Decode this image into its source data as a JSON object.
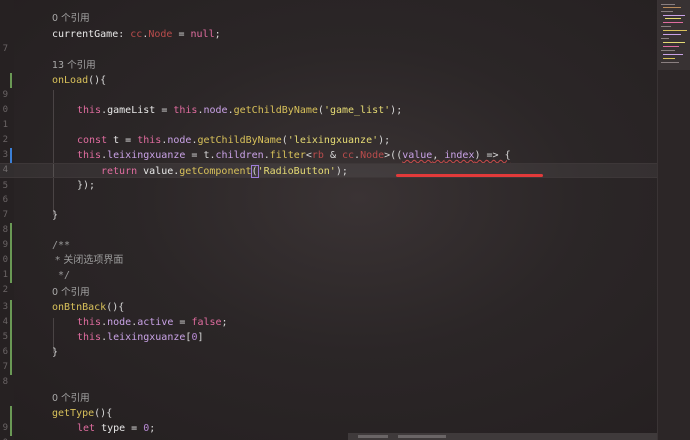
{
  "editor": {
    "codelens": {
      "line0": "0 个引用",
      "line3": "13 个引用",
      "line18": "0 个引用",
      "line25": "0 个引用"
    },
    "line_numbers": [
      "",
      "7",
      "",
      "",
      "9",
      "0",
      "1",
      "2",
      "3",
      "4",
      "5",
      "6",
      "7",
      "8",
      "9",
      "0",
      "1",
      "2",
      "3",
      "4",
      "5",
      "6",
      "7",
      "8",
      "",
      "9",
      "0"
    ],
    "code": {
      "l1_a": "currentGame",
      "l1_b": ": ",
      "l1_c": "cc",
      "l1_d": ".",
      "l1_e": "Node",
      "l1_f": " = ",
      "l1_g": "null",
      "l1_h": ";",
      "l4_a": "onLoad",
      "l4_b": "(){",
      "l6_a": "this",
      "l6_b": ".",
      "l6_c": "gameList",
      "l6_d": " = ",
      "l6_e": "this",
      "l6_f": ".",
      "l6_g": "node",
      "l6_h": ".",
      "l6_i": "getChildByName",
      "l6_j": "(",
      "l6_k": "'game_list'",
      "l6_l": ");",
      "l8_a": "const",
      "l8_b": " t = ",
      "l8_c": "this",
      "l8_d": ".",
      "l8_e": "node",
      "l8_f": ".",
      "l8_g": "getChildByName",
      "l8_h": "(",
      "l8_i": "'leixingxuanze'",
      "l8_j": ");",
      "l9_a": "this",
      "l9_b": ".",
      "l9_c": "leixingxuanze",
      "l9_d": " = t.",
      "l9_e": "children",
      "l9_f": ".",
      "l9_g": "filter",
      "l9_h": "<",
      "l9_i": "rb",
      "l9_j": " & ",
      "l9_k": "cc",
      "l9_l": ".",
      "l9_m": "Node",
      "l9_n": ">((",
      "l9_o": "value",
      "l9_p": ", ",
      "l9_q": "index",
      "l9_r": ") => {",
      "l10_a": "return",
      "l10_b": " value.",
      "l10_c": "getComponent",
      "l10_d": "(",
      "l10_e": "'RadioButton'",
      "l10_f": ");",
      "l11_a": "});",
      "l13_a": "}",
      "l15_a": "/**",
      "l16_a": " * 关闭选项界面",
      "l17_a": " */",
      "l19_a": "onBtnBack",
      "l19_b": "(){",
      "l20_a": "this",
      "l20_b": ".",
      "l20_c": "node",
      "l20_d": ".",
      "l20_e": "active",
      "l20_f": " = ",
      "l20_g": "false",
      "l20_h": ";",
      "l21_a": "this",
      "l21_b": ".",
      "l21_c": "leixingxuanze",
      "l21_d": "[",
      "l21_e": "0",
      "l21_f": "]",
      "l22_a": "}",
      "l26_a": "getType",
      "l26_b": "(){",
      "l27_a": "let",
      "l27_b": " type = ",
      "l27_c": "0",
      "l27_d": ";"
    }
  },
  "colors": {
    "background": "#2a2526",
    "keyword": "#e06c9f",
    "function": "#d8c15a",
    "string": "#e6db74",
    "property": "#c9a2e6",
    "annotation_stroke": "#e23a3a",
    "change_marker_green": "#6a9955",
    "change_marker_blue": "#3b7fd6"
  }
}
